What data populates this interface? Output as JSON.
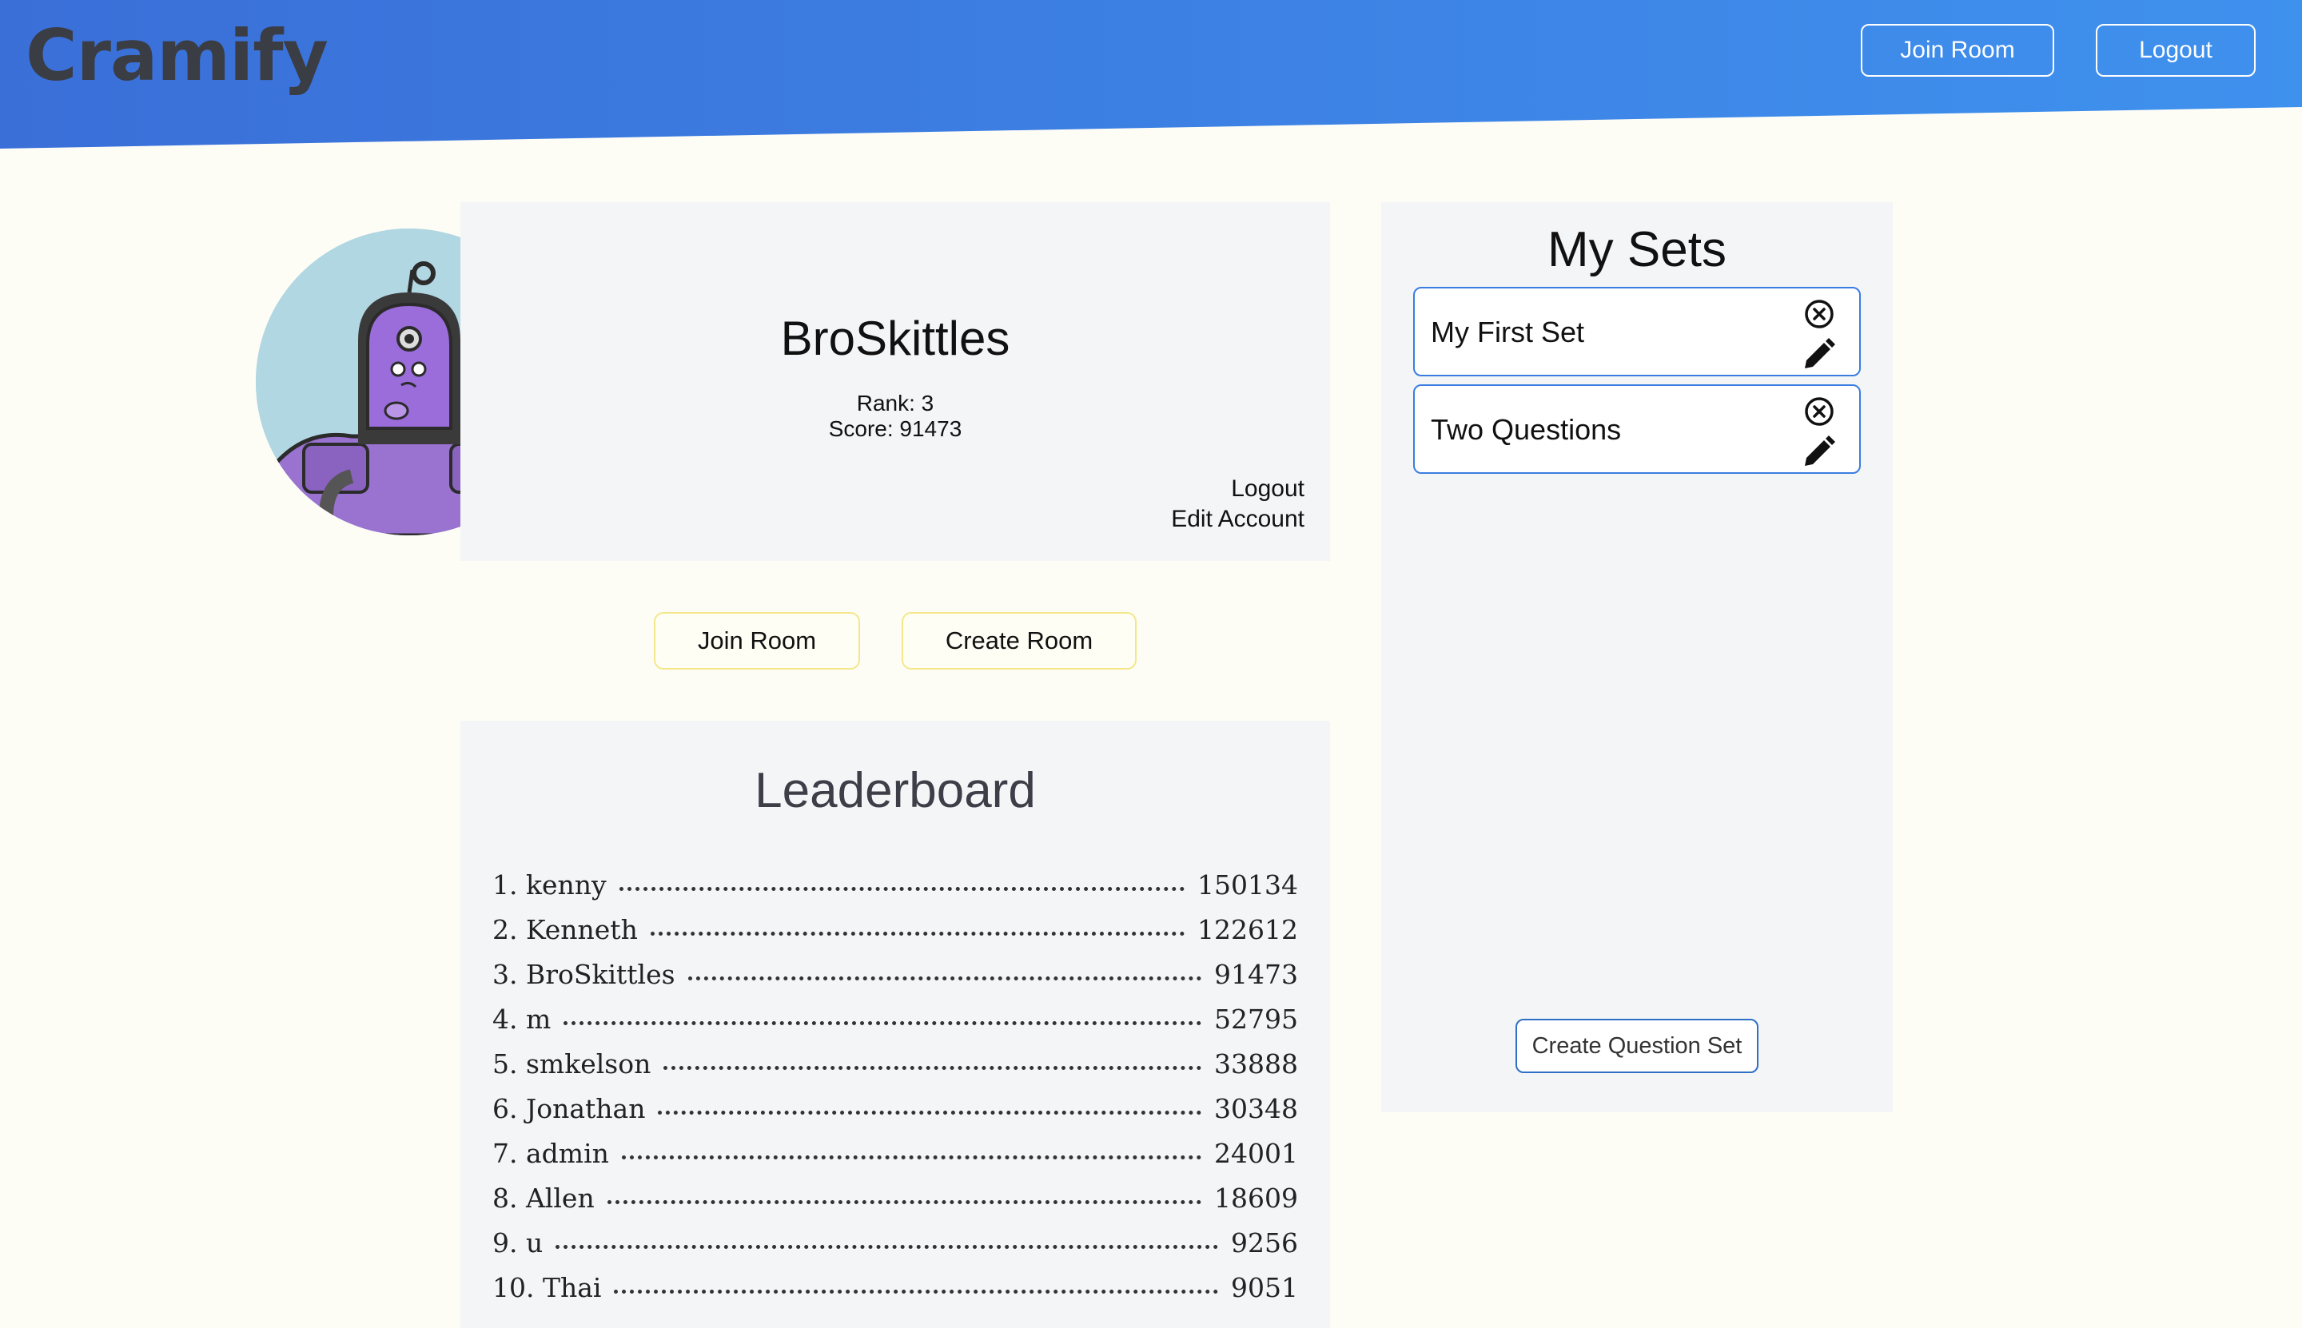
{
  "header": {
    "logo": "Cramify",
    "join_room": "Join Room",
    "logout": "Logout",
    "gradient": [
      "#3a6fd8",
      "#3f91ee"
    ]
  },
  "profile": {
    "username": "BroSkittles",
    "rank": "Rank: 3",
    "score": "Score: 91473",
    "logout": "Logout",
    "edit_account": "Edit Account"
  },
  "actions": {
    "join_room": "Join Room",
    "create_room": "Create Room"
  },
  "leaderboard": {
    "title": "Leaderboard",
    "entries": [
      {
        "name": "1. kenny",
        "score": "150134"
      },
      {
        "name": "2. Kenneth",
        "score": "122612"
      },
      {
        "name": "3. BroSkittles",
        "score": "91473"
      },
      {
        "name": "4. m",
        "score": "52795"
      },
      {
        "name": "5. smkelson",
        "score": "33888"
      },
      {
        "name": "6. Jonathan",
        "score": "30348"
      },
      {
        "name": "7. admin",
        "score": "24001"
      },
      {
        "name": "8. Allen",
        "score": "18609"
      },
      {
        "name": "9. u",
        "score": "9256"
      },
      {
        "name": "10. Thai",
        "score": "9051"
      }
    ]
  },
  "sets": {
    "title": "My Sets",
    "items": [
      {
        "label": "My First Set"
      },
      {
        "label": "Two Questions"
      }
    ],
    "create_button": "Create Question Set"
  },
  "icons": {
    "avatar": "robot-avatar-icon",
    "delete": "circle-x-icon",
    "edit": "pencil-icon"
  }
}
